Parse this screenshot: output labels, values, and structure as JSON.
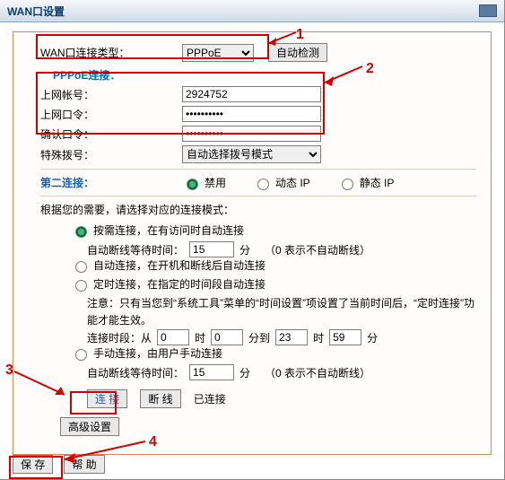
{
  "titlebar": {
    "title": "WAN口设置"
  },
  "wan": {
    "label": "WAN口连接类型：",
    "select_value": "PPPoE",
    "auto_detect": "自动检测"
  },
  "pppoe": {
    "section_title": "PPPoE连接：",
    "account_label": "上网帐号：",
    "account_value": "2924752",
    "password_label": "上网口令：",
    "password_value": "••••••••••",
    "confirm_label": "确认口令：",
    "confirm_value": "••••••••••",
    "special_dial_label": "特殊拨号：",
    "special_dial_value": "自动选择拨号模式"
  },
  "second": {
    "section_title": "第二连接：",
    "options": {
      "disable": "禁用",
      "dynip": "动态 IP",
      "staticip": "静态 IP"
    }
  },
  "mode": {
    "intro": "根据您的需要，请选择对应的连接模式：",
    "ondemand": {
      "label": "按需连接，在有访问时自动连接",
      "idle_label_pre": "自动断线等待时间：",
      "idle_value": "15",
      "idle_unit": "分",
      "idle_note": "（0 表示不自动断线）"
    },
    "auto": {
      "label": "自动连接，在开机和断线后自动连接"
    },
    "timed": {
      "label": "定时连接，在指定的时间段自动连接",
      "note": "注意：只有当您到“系统工具”菜单的“时间设置”项设置了当前时间后，“定时连接”功能才能生效。",
      "period_pre": "连接时段：从",
      "h1": "0",
      "m1": "0",
      "h2": "23",
      "m2": "59",
      "hr_unit": "时",
      "min_unit": "分",
      "to": "分到"
    },
    "manual": {
      "label": "手动连接，由用户手动连接",
      "idle_label_pre": "自动断线等待时间：",
      "idle_value": "15",
      "idle_unit": "分",
      "idle_note": "（0 表示不自动断线）"
    }
  },
  "conn": {
    "connect_btn": "连 接",
    "disconnect_btn": "断 线",
    "status": "已连接",
    "advanced": "高级设置"
  },
  "footer": {
    "save": "保 存",
    "help": "帮 助"
  },
  "annotations": {
    "a1": "1",
    "a2": "2",
    "a3": "3",
    "a4": "4"
  }
}
